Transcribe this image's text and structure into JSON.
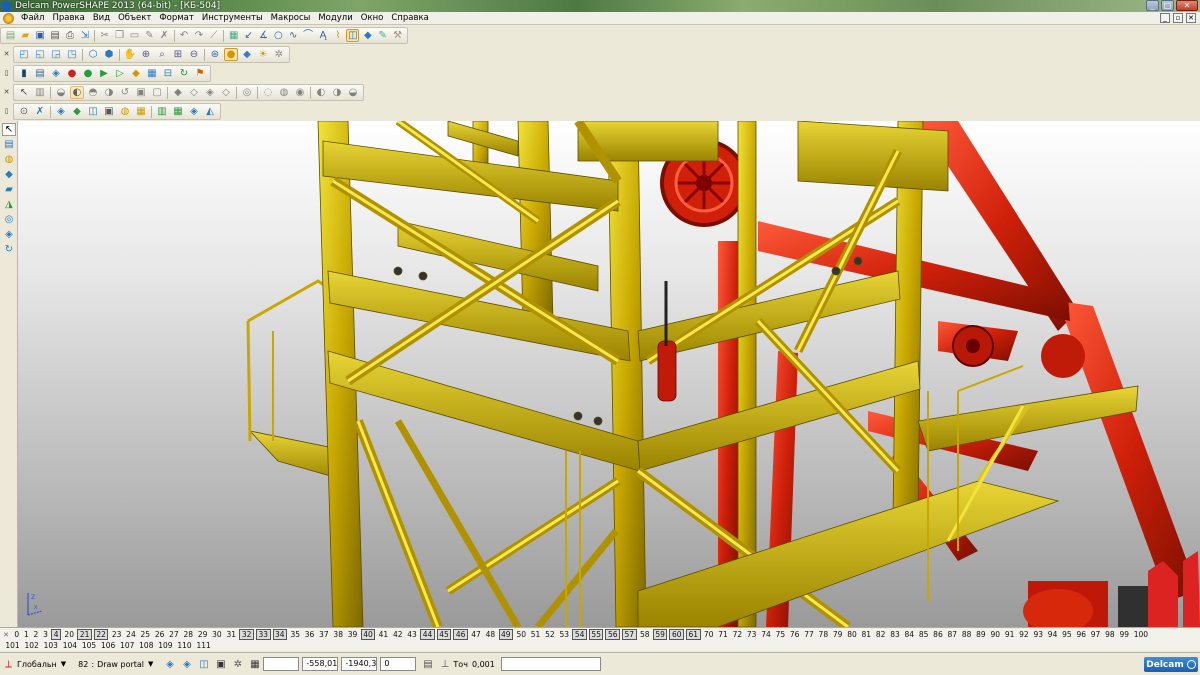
{
  "title": "Delcam PowerSHAPE 2013 (64-bit) - [КБ-504]",
  "menu": [
    "Файл",
    "Правка",
    "Вид",
    "Объект",
    "Формат",
    "Инструменты",
    "Макросы",
    "Модули",
    "Окно",
    "Справка"
  ],
  "toolbars": {
    "row1": [
      "new-icon",
      "open-icon",
      "save-icon",
      "save-as-icon",
      "print-icon",
      "import-icon",
      "cut-icon",
      "copy-icon",
      "paste-icon",
      "delete-icon",
      "undo-icon",
      "redo-icon",
      "select-icon",
      "wireframe-icon",
      "rotate-icon",
      "arc-icon",
      "circle-icon",
      "curve-icon",
      "spline-icon",
      "surface-icon",
      "shaded-icon",
      "solid-icon",
      "sketch-icon",
      "text-icon"
    ],
    "row2": [
      "views-icon",
      "views-2-icon",
      "views-3-icon",
      "views-4-icon",
      "iso-icon",
      "iso-2-icon",
      "pan-icon",
      "zoom-icon",
      "zoom-in-icon",
      "zoom-out-icon",
      "globe-icon",
      "shade-icon",
      "solid-view-icon",
      "light-icon",
      "render-icon"
    ],
    "row3": [
      "measure-icon",
      "document-icon",
      "cube-blue-icon",
      "sphere-red-icon",
      "sphere-green-icon",
      "triangle-green-icon",
      "cube-yellow-icon",
      "grid-icon",
      "tree-icon",
      "refresh-icon",
      "flag-icon"
    ],
    "row4": [
      "cursor-icon",
      "doc-icon",
      "solid-a-icon",
      "solid-b-icon",
      "solid-c-icon",
      "solid-d-icon",
      "solid-e-icon",
      "solid-f-icon",
      "solid-g-icon",
      "solid-h-icon",
      "solid-i-icon",
      "solid-j-icon",
      "solid-k-icon",
      "solid-l-icon",
      "solid-m-icon",
      "solid-n-icon",
      "solid-o-icon"
    ],
    "row5": [
      "select-mode-icon",
      "scissor-icon",
      "xy-icon",
      "extrude-icon",
      "chamfer-icon",
      "boolean-icon",
      "shell-icon",
      "fillet-icon",
      "pattern-icon",
      "mirror-icon",
      "array-icon",
      "offset-icon",
      "split-icon",
      "sweep-icon"
    ]
  },
  "left_toolbar": [
    "select-arrow-icon",
    "paint-icon",
    "solid-add-icon",
    "box-icon",
    "cylinder-icon",
    "cone-icon",
    "torus-icon",
    "extrusion-icon",
    "spin-icon"
  ],
  "viewport": {
    "axis_label": "Z",
    "axis_label2": "X"
  },
  "levels_row1": [
    {
      "n": "0",
      "b": false
    },
    {
      "n": "1",
      "b": false
    },
    {
      "n": "2",
      "b": false
    },
    {
      "n": "3",
      "b": false
    },
    {
      "n": "4",
      "b": true
    },
    {
      "n": "20",
      "b": false
    },
    {
      "n": "21",
      "b": true
    },
    {
      "n": "22",
      "b": true
    },
    {
      "n": "23",
      "b": false
    },
    {
      "n": "24",
      "b": false
    },
    {
      "n": "25",
      "b": false
    },
    {
      "n": "26",
      "b": false
    },
    {
      "n": "27",
      "b": false
    },
    {
      "n": "28",
      "b": false
    },
    {
      "n": "29",
      "b": false
    },
    {
      "n": "30",
      "b": false
    },
    {
      "n": "31",
      "b": false
    },
    {
      "n": "32",
      "b": true
    },
    {
      "n": "33",
      "b": true
    },
    {
      "n": "34",
      "b": true
    },
    {
      "n": "35",
      "b": false
    },
    {
      "n": "36",
      "b": false
    },
    {
      "n": "37",
      "b": false
    },
    {
      "n": "38",
      "b": false
    },
    {
      "n": "39",
      "b": false
    },
    {
      "n": "40",
      "b": true
    },
    {
      "n": "41",
      "b": false
    },
    {
      "n": "42",
      "b": false
    },
    {
      "n": "43",
      "b": false
    },
    {
      "n": "44",
      "b": true
    },
    {
      "n": "45",
      "b": true
    },
    {
      "n": "46",
      "b": true
    },
    {
      "n": "47",
      "b": false
    },
    {
      "n": "48",
      "b": false
    },
    {
      "n": "49",
      "b": true
    },
    {
      "n": "50",
      "b": false
    },
    {
      "n": "51",
      "b": false
    },
    {
      "n": "52",
      "b": false
    },
    {
      "n": "53",
      "b": false
    },
    {
      "n": "54",
      "b": true
    },
    {
      "n": "55",
      "b": true
    },
    {
      "n": "56",
      "b": true
    },
    {
      "n": "57",
      "b": true
    },
    {
      "n": "58",
      "b": false
    },
    {
      "n": "59",
      "b": true
    },
    {
      "n": "60",
      "b": true
    },
    {
      "n": "61",
      "b": true
    },
    {
      "n": "70",
      "b": false
    },
    {
      "n": "71",
      "b": false
    },
    {
      "n": "72",
      "b": false
    },
    {
      "n": "73",
      "b": false
    },
    {
      "n": "74",
      "b": false
    },
    {
      "n": "75",
      "b": false
    },
    {
      "n": "76",
      "b": false
    },
    {
      "n": "77",
      "b": false
    },
    {
      "n": "78",
      "b": false
    },
    {
      "n": "79",
      "b": false
    },
    {
      "n": "80",
      "b": false
    },
    {
      "n": "81",
      "b": false
    },
    {
      "n": "82",
      "b": false
    },
    {
      "n": "83",
      "b": false
    },
    {
      "n": "84",
      "b": false
    },
    {
      "n": "85",
      "b": false
    },
    {
      "n": "86",
      "b": false
    },
    {
      "n": "87",
      "b": false
    },
    {
      "n": "88",
      "b": false
    },
    {
      "n": "89",
      "b": false
    },
    {
      "n": "90",
      "b": false
    },
    {
      "n": "91",
      "b": false
    },
    {
      "n": "92",
      "b": false
    },
    {
      "n": "93",
      "b": false
    },
    {
      "n": "94",
      "b": false
    },
    {
      "n": "95",
      "b": false
    },
    {
      "n": "96",
      "b": false
    },
    {
      "n": "97",
      "b": false
    },
    {
      "n": "98",
      "b": false
    },
    {
      "n": "99",
      "b": false
    },
    {
      "n": "100",
      "b": false
    }
  ],
  "levels_row2": [
    "101",
    "102",
    "103",
    "104",
    "105",
    "106",
    "107",
    "108",
    "109",
    "110",
    "111"
  ],
  "status": {
    "workplane": "Глобальн",
    "level_num": "82",
    "level_name": "Draw portal",
    "x": "-558,01",
    "y": "-1940,3",
    "z": "0",
    "tol_label": "Точ",
    "tol_value": "0,001",
    "brand": "Delcam"
  },
  "colors": {
    "yellow": "#c8a800",
    "red": "#c81e0a",
    "accent": "#1b5fb0"
  }
}
